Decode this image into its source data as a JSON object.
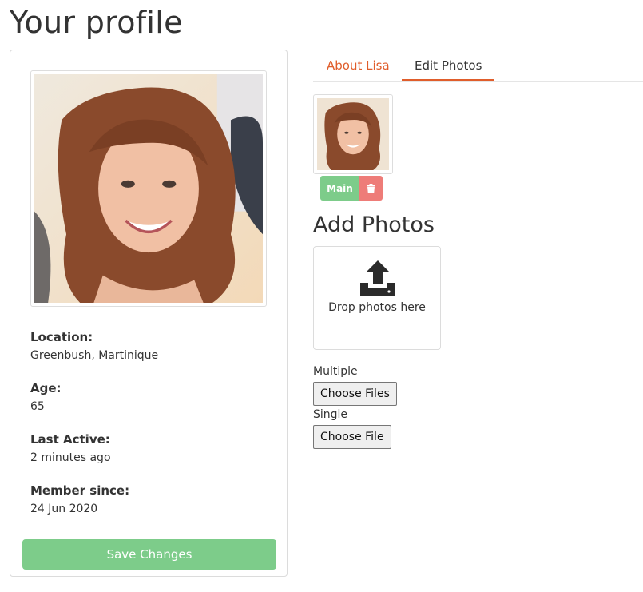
{
  "page": {
    "title": "Your profile"
  },
  "profile": {
    "fields": [
      {
        "label": "Location:",
        "value": "Greenbush, Martinique"
      },
      {
        "label": "Age:",
        "value": "65"
      },
      {
        "label": "Last Active:",
        "value": "2 minutes ago"
      },
      {
        "label": "Member since:",
        "value": "24 Jun 2020"
      }
    ],
    "save_label": "Save Changes"
  },
  "tabs": [
    {
      "label": "About Lisa",
      "active": false
    },
    {
      "label": "Edit Photos",
      "active": true
    }
  ],
  "photos": {
    "main_label": "Main",
    "add_title": "Add Photos",
    "dropzone_text": "Drop photos here",
    "multiple_label": "Multiple",
    "multiple_button": "Choose Files",
    "single_label": "Single",
    "single_button": "Choose File"
  },
  "colors": {
    "accent": "#e05d2b",
    "success": "#7dcc8a",
    "danger": "#ee7c78"
  },
  "icons": {
    "upload": "upload-icon",
    "delete": "trash-icon"
  }
}
